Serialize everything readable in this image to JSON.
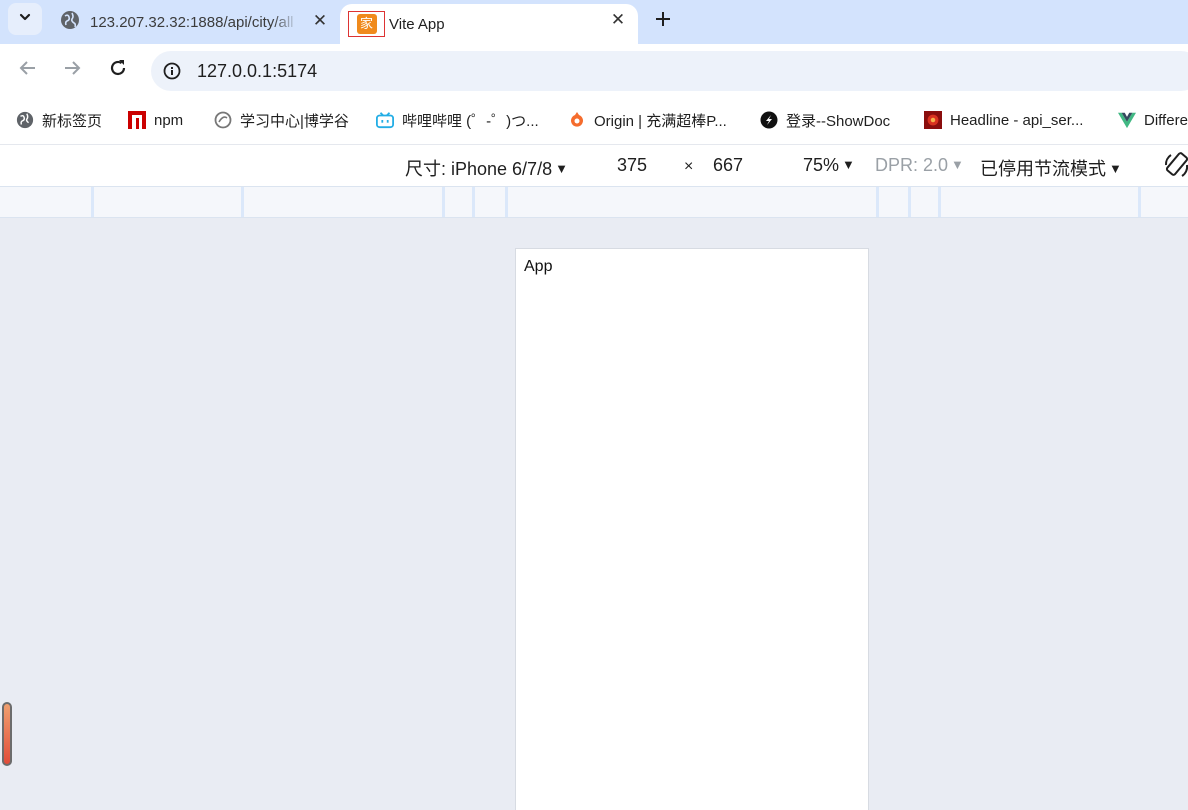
{
  "tabs": {
    "search_icon": "chevron-down-icon",
    "items": [
      {
        "title": "123.207.32.32:1888/api/city/all",
        "favicon": "globe-icon",
        "active": false
      },
      {
        "title": "Vite App",
        "favicon": "家",
        "active": true
      }
    ],
    "close_icon": "close-icon",
    "new_tab_icon": "plus-icon"
  },
  "toolbar": {
    "back_icon": "arrow-left-icon",
    "forward_icon": "arrow-right-icon",
    "reload_icon": "reload-icon",
    "site_info_icon": "info-icon",
    "url": "127.0.0.1:5174"
  },
  "bookmarks": [
    {
      "label": "新标签页",
      "icon": "globe-icon"
    },
    {
      "label": "npm",
      "icon": "npm-icon"
    },
    {
      "label": "学习中心|博学谷",
      "icon": "boxuegu-icon"
    },
    {
      "label": "哔哩哔哩 (゜-゜)つ...",
      "icon": "bilibili-icon"
    },
    {
      "label": "Origin | 充满超棒P...",
      "icon": "origin-icon"
    },
    {
      "label": "登录--ShowDoc",
      "icon": "showdoc-icon"
    },
    {
      "label": "Headline - api_ser...",
      "icon": "headline-icon"
    },
    {
      "label": "Differe",
      "icon": "vue-icon"
    }
  ],
  "device_toolbar": {
    "dimensions_label": "尺寸: iPhone 6/7/8",
    "width": "375",
    "times": "×",
    "height": "667",
    "zoom": "75%",
    "dpr": "DPR: 2.0",
    "throttling": "已停用节流模式",
    "rotate_icon": "rotate-icon"
  },
  "page": {
    "content_text": "App"
  },
  "colors": {
    "tabstrip": "#d3e3fd",
    "omnibox": "#edf2fa",
    "viewport_bg": "#e9ecf3"
  }
}
